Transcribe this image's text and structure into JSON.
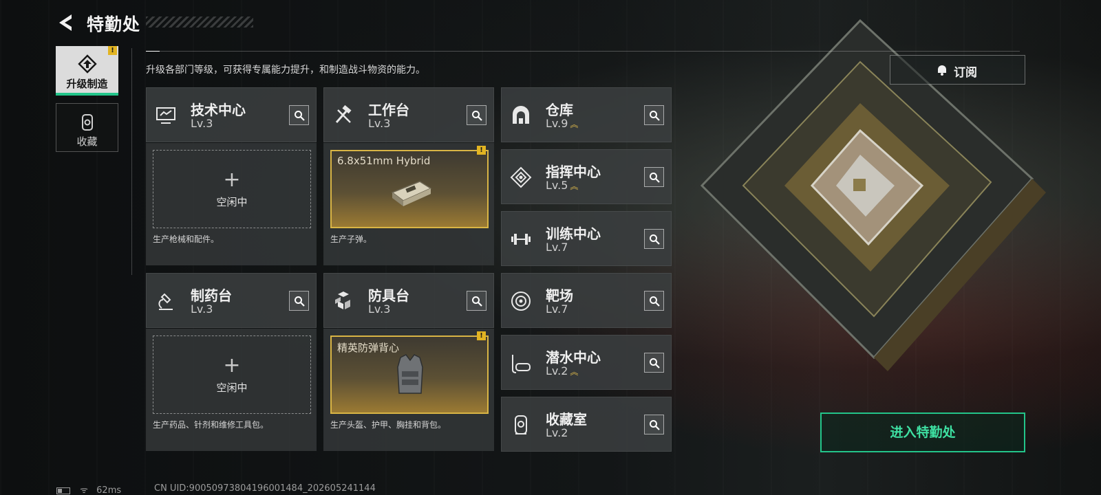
{
  "header": {
    "title": "特勤处",
    "subtitle": "升级各部门等级，可获得专属能力提升，和制造战斗物资的能力。"
  },
  "sidebar": {
    "tabs": [
      {
        "label": "升级制造",
        "icon": "upgrade-icon",
        "active": true,
        "alert": "!"
      },
      {
        "label": "收藏",
        "icon": "collection-icon",
        "active": false
      }
    ]
  },
  "departments": {
    "tech": {
      "name": "技术中心",
      "level": "Lv.3",
      "icon": "monitor-icon"
    },
    "workbench": {
      "name": "工作台",
      "level": "Lv.3",
      "icon": "hammer-wrench-icon"
    },
    "pharma": {
      "name": "制药台",
      "level": "Lv.3",
      "icon": "microscope-icon"
    },
    "armor": {
      "name": "防具台",
      "level": "Lv.3",
      "icon": "cubes-icon"
    },
    "warehouse": {
      "name": "仓库",
      "level": "Lv.9",
      "icon": "vault-icon",
      "upgradable": true
    },
    "command": {
      "name": "指挥中心",
      "level": "Lv.5",
      "icon": "command-diamond-icon",
      "upgradable": true
    },
    "training": {
      "name": "训练中心",
      "level": "Lv.7",
      "icon": "dumbbell-icon"
    },
    "range": {
      "name": "靶场",
      "level": "Lv.7",
      "icon": "target-icon"
    },
    "diving": {
      "name": "潜水中心",
      "level": "Lv.2",
      "icon": "diving-mask-icon",
      "upgradable": true
    },
    "collect": {
      "name": "收藏室",
      "level": "Lv.2",
      "icon": "collection-room-icon"
    }
  },
  "production": {
    "tech": {
      "status": "空闲中",
      "desc": "生产枪械和配件。"
    },
    "workbench": {
      "item": "6.8x51mm Hybrid",
      "desc": "生产子弹。",
      "alert": "!"
    },
    "pharma": {
      "status": "空闲中",
      "desc": "生产药品、针剂和维修工具包。"
    },
    "armor": {
      "item": "精英防弹背心",
      "desc": "生产头盔、护甲、胸挂和背包。",
      "alert": "!"
    }
  },
  "plus_glyph": "+",
  "upgrade_chevron": "︽",
  "actions": {
    "subscribe": "订阅",
    "enter": "进入特勤处"
  },
  "status_bar": {
    "ping": "62ms",
    "uid": "CN UID:9005097380419600148​4_202605241144"
  },
  "colors": {
    "accent_green": "#23c58a",
    "alert_gold": "#e2b422",
    "item_border_gold": "#d9b545"
  }
}
